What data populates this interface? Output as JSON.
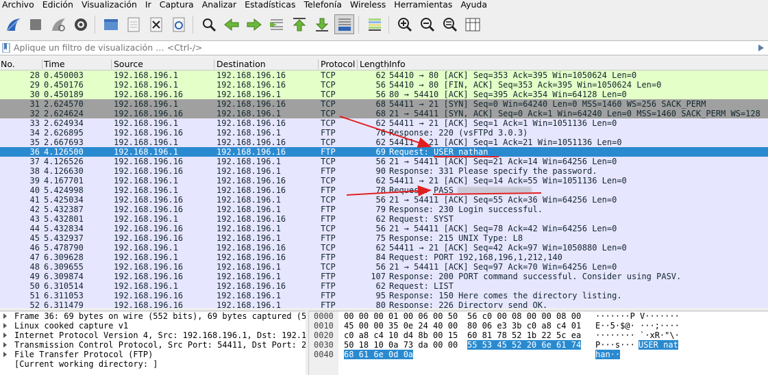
{
  "menubar": [
    "Archivo",
    "Edición",
    "Visualización",
    "Ir",
    "Captura",
    "Analizar",
    "Estadísticas",
    "Telefonía",
    "Wireless",
    "Herramientas",
    "Ayuda"
  ],
  "toolbar": [
    {
      "name": "start-capture-icon"
    },
    {
      "name": "stop-capture-icon"
    },
    {
      "name": "restart-capture-icon"
    },
    {
      "name": "capture-options-icon"
    },
    {
      "sep": true
    },
    {
      "name": "open-file-icon"
    },
    {
      "name": "save-file-icon"
    },
    {
      "name": "close-file-icon"
    },
    {
      "name": "reload-file-icon"
    },
    {
      "sep": true
    },
    {
      "name": "find-packet-icon"
    },
    {
      "name": "go-back-icon"
    },
    {
      "name": "go-forward-icon"
    },
    {
      "name": "go-to-packet-icon"
    },
    {
      "name": "go-first-icon"
    },
    {
      "name": "go-last-icon"
    },
    {
      "name": "autoscroll-icon"
    },
    {
      "sep": true
    },
    {
      "name": "colorize-icon"
    },
    {
      "sep": true
    },
    {
      "name": "zoom-in-icon"
    },
    {
      "name": "zoom-out-icon"
    },
    {
      "name": "zoom-normal-icon"
    },
    {
      "name": "resize-columns-icon"
    }
  ],
  "filter": {
    "placeholder": "Aplique un filtro de visualización … <Ctrl-/>"
  },
  "columns": {
    "no": "No.",
    "time": "Time",
    "source": "Source",
    "destination": "Destination",
    "protocol": "Protocol",
    "length": "Length",
    "info": "Info"
  },
  "colors": {
    "tcp": "#e7e6ff",
    "tcp_fin": "#a0a0a0",
    "ftp": "#e7e6ff",
    "http_green": "#e4ffc7",
    "selected": "#2a8ad0",
    "dark_text": "#12272e",
    "arrow": "#e02020"
  },
  "packets": [
    {
      "no": "28",
      "time": "0.450003",
      "src": "192.168.196.1",
      "dst": "192.168.196.16",
      "proto": "TCP",
      "len": "62",
      "info": "54410 → 80 [ACK] Seq=353 Ack=395 Win=1050624 Len=0",
      "style": "green"
    },
    {
      "no": "29",
      "time": "0.450176",
      "src": "192.168.196.1",
      "dst": "192.168.196.16",
      "proto": "TCP",
      "len": "56",
      "info": "54410 → 80 [FIN, ACK] Seq=353 Ack=395 Win=1050624 Len=0",
      "style": "green"
    },
    {
      "no": "30",
      "time": "0.450189",
      "src": "192.168.196.16",
      "dst": "192.168.196.1",
      "proto": "TCP",
      "len": "56",
      "info": "80 → 54410 [ACK] Seq=395 Ack=354 Win=64128 Len=0",
      "style": "green"
    },
    {
      "no": "31",
      "time": "2.624570",
      "src": "192.168.196.1",
      "dst": "192.168.196.16",
      "proto": "TCP",
      "len": "68",
      "info": "54411 → 21 [SYN] Seq=0 Win=64240 Len=0 MSS=1460 WS=256 SACK_PERM",
      "style": "gray"
    },
    {
      "no": "32",
      "time": "2.624624",
      "src": "192.168.196.16",
      "dst": "192.168.196.1",
      "proto": "TCP",
      "len": "68",
      "info": "21 → 54411 [SYN, ACK] Seq=0 Ack=1 Win=64240 Len=0 MSS=1460 SACK_PERM WS=128",
      "style": "gray"
    },
    {
      "no": "33",
      "time": "2.624934",
      "src": "192.168.196.1",
      "dst": "192.168.196.16",
      "proto": "TCP",
      "len": "62",
      "info": "54411 → 21 [ACK] Seq=1 Ack=1 Win=1051136 Len=0",
      "style": "lav"
    },
    {
      "no": "34",
      "time": "2.626895",
      "src": "192.168.196.16",
      "dst": "192.168.196.1",
      "proto": "FTP",
      "len": "76",
      "info": "Response: 220 (vsFTPd 3.0.3)",
      "style": "lav"
    },
    {
      "no": "35",
      "time": "2.667693",
      "src": "192.168.196.1",
      "dst": "192.168.196.16",
      "proto": "TCP",
      "len": "62",
      "info": "54411 → 21 [ACK] Seq=1 Ack=21 Win=1051136 Len=0",
      "style": "lav"
    },
    {
      "no": "36",
      "time": "4.126500",
      "src": "192.168.196.1",
      "dst": "192.168.196.16",
      "proto": "FTP",
      "len": "69",
      "info": "Request: USER nathan",
      "style": "selected"
    },
    {
      "no": "37",
      "time": "4.126526",
      "src": "192.168.196.16",
      "dst": "192.168.196.1",
      "proto": "TCP",
      "len": "56",
      "info": "21 → 54411 [ACK] Seq=21 Ack=14 Win=64256 Len=0",
      "style": "lav"
    },
    {
      "no": "38",
      "time": "4.126630",
      "src": "192.168.196.16",
      "dst": "192.168.196.1",
      "proto": "FTP",
      "len": "90",
      "info": "Response: 331 Please specify the password.",
      "style": "lav"
    },
    {
      "no": "39",
      "time": "4.167701",
      "src": "192.168.196.1",
      "dst": "192.168.196.16",
      "proto": "TCP",
      "len": "62",
      "info": "54411 → 21 [ACK] Seq=14 Ack=55 Win=1051136 Len=0",
      "style": "lav"
    },
    {
      "no": "40",
      "time": "5.424998",
      "src": "192.168.196.1",
      "dst": "192.168.196.16",
      "proto": "FTP",
      "len": "78",
      "info": "Request: PASS",
      "style": "lav",
      "redacted": true
    },
    {
      "no": "41",
      "time": "5.425034",
      "src": "192.168.196.16",
      "dst": "192.168.196.1",
      "proto": "TCP",
      "len": "56",
      "info": "21 → 54411 [ACK] Seq=55 Ack=36 Win=64256 Len=0",
      "style": "lav"
    },
    {
      "no": "42",
      "time": "5.432387",
      "src": "192.168.196.16",
      "dst": "192.168.196.1",
      "proto": "FTP",
      "len": "79",
      "info": "Response: 230 Login successful.",
      "style": "lav"
    },
    {
      "no": "43",
      "time": "5.432801",
      "src": "192.168.196.1",
      "dst": "192.168.196.16",
      "proto": "FTP",
      "len": "62",
      "info": "Request: SYST",
      "style": "lav"
    },
    {
      "no": "44",
      "time": "5.432834",
      "src": "192.168.196.16",
      "dst": "192.168.196.1",
      "proto": "TCP",
      "len": "56",
      "info": "21 → 54411 [ACK] Seq=78 Ack=42 Win=64256 Len=0",
      "style": "lav"
    },
    {
      "no": "45",
      "time": "5.432937",
      "src": "192.168.196.16",
      "dst": "192.168.196.1",
      "proto": "FTP",
      "len": "75",
      "info": "Response: 215 UNIX Type: L8",
      "style": "lav"
    },
    {
      "no": "46",
      "time": "5.478790",
      "src": "192.168.196.1",
      "dst": "192.168.196.16",
      "proto": "TCP",
      "len": "62",
      "info": "54411 → 21 [ACK] Seq=42 Ack=97 Win=1050880 Len=0",
      "style": "lav"
    },
    {
      "no": "47",
      "time": "6.309628",
      "src": "192.168.196.1",
      "dst": "192.168.196.16",
      "proto": "FTP",
      "len": "84",
      "info": "Request: PORT 192,168,196,1,212,140",
      "style": "lav"
    },
    {
      "no": "48",
      "time": "6.309655",
      "src": "192.168.196.16",
      "dst": "192.168.196.1",
      "proto": "TCP",
      "len": "56",
      "info": "21 → 54411 [ACK] Seq=97 Ack=70 Win=64256 Len=0",
      "style": "lav"
    },
    {
      "no": "49",
      "time": "6.309874",
      "src": "192.168.196.16",
      "dst": "192.168.196.1",
      "proto": "FTP",
      "len": "107",
      "info": "Response: 200 PORT command successful. Consider using PASV.",
      "style": "lav"
    },
    {
      "no": "50",
      "time": "6.310514",
      "src": "192.168.196.1",
      "dst": "192.168.196.16",
      "proto": "FTP",
      "len": "62",
      "info": "Request: LIST",
      "style": "lav"
    },
    {
      "no": "51",
      "time": "6.311053",
      "src": "192.168.196.16",
      "dst": "192.168.196.1",
      "proto": "FTP",
      "len": "95",
      "info": "Response: 150 Here comes the directory listing.",
      "style": "lav"
    },
    {
      "no": "52",
      "time": "6.311479",
      "src": "192.168.196.16",
      "dst": "192.168.196.1",
      "proto": "FTP",
      "len": "80",
      "info": "Response: 226 Directory send OK.",
      "style": "lav"
    }
  ],
  "details": [
    {
      "text": "Frame 36: 69 bytes on wire (552 bits), 69 bytes captured (5",
      "tri": true
    },
    {
      "text": "Linux cooked capture v1",
      "tri": true
    },
    {
      "text": "Internet Protocol Version 4, Src: 192.168.196.1, Dst: 192.1",
      "tri": true
    },
    {
      "text": "Transmission Control Protocol, Src Port: 54411, Dst Port: 2",
      "tri": true
    },
    {
      "text": "File Transfer Protocol (FTP)",
      "tri": true
    },
    {
      "text": "[Current working directory: ]",
      "tri": false
    }
  ],
  "hex": [
    {
      "off": "0000",
      "b1": "00 00 00 01 00 06 00 50",
      "b2": "56 c0 00 08 00 00 08 00",
      "asc": "·······P V·······",
      "hl_b2": "",
      "hl_asc": ""
    },
    {
      "off": "0010",
      "b1": "45 00 00 35 0e 24 40 00",
      "b2": "80 06 e3 3b c0 a8 c4 01",
      "asc": "E··5·$@· ···;····",
      "hl_b2": "",
      "hl_asc": ""
    },
    {
      "off": "0020",
      "b1": "c0 a8 c4 10 d4 8b 00 15",
      "b2": "60 81 78 52 1b 22 5c ea",
      "asc": "········ `·xR·\"\\·",
      "hl_b2": "",
      "hl_asc": ""
    },
    {
      "off": "0030",
      "b1": "50 18 10 0a 73 da 00 00",
      "b2": "",
      "asc": "P···s···",
      "hl_b2": "55 53 45 52 20 6e 61 74",
      "hl_asc": "USER nat"
    },
    {
      "off": "0040",
      "b1": "",
      "b2": "",
      "asc": "",
      "hl_b1": "68 61 6e 0d 0a",
      "hl_asc2": "han··"
    }
  ]
}
